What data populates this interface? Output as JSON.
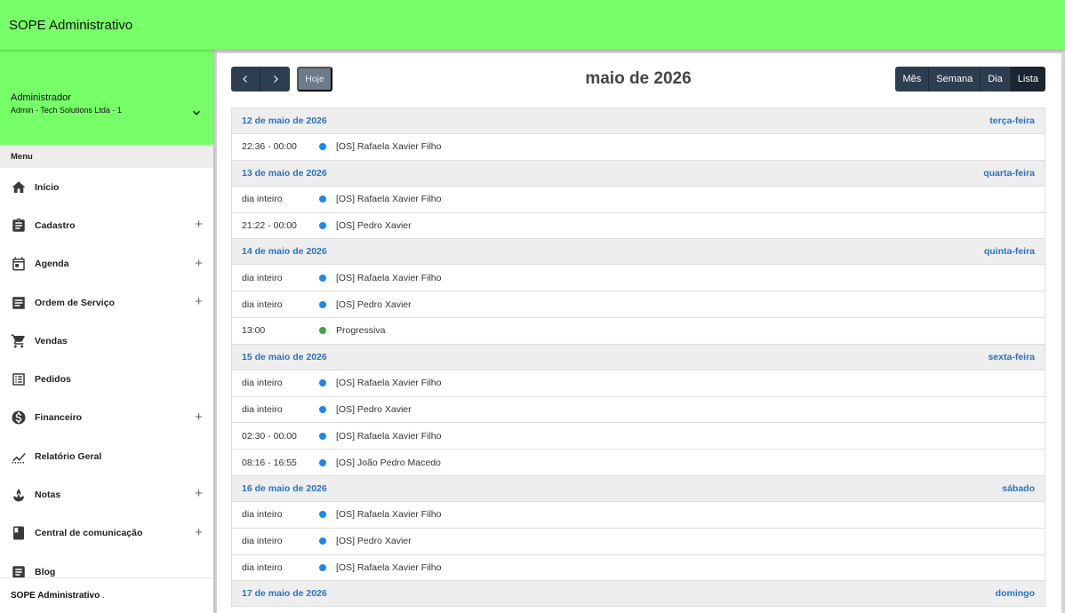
{
  "topbar": {
    "title": "SOPE Administrativo"
  },
  "user": {
    "name": "Administrador",
    "company": "Admin - Tech Solutions Ltda - 1"
  },
  "menu": {
    "header": "Menu",
    "items": [
      {
        "label": "Início",
        "icon": "home-icon",
        "expandable": false
      },
      {
        "label": "Cadastro",
        "icon": "clipboard-icon",
        "expandable": true
      },
      {
        "label": "Agenda",
        "icon": "calendar-icon",
        "expandable": true
      },
      {
        "label": "Ordem de Serviço",
        "icon": "document-list-icon",
        "expandable": true
      },
      {
        "label": "Vendas",
        "icon": "cart-icon",
        "expandable": false
      },
      {
        "label": "Pedidos",
        "icon": "list-icon",
        "expandable": false
      },
      {
        "label": "Financeiro",
        "icon": "dollar-icon",
        "expandable": true
      },
      {
        "label": "Relatório Geral",
        "icon": "chart-line-icon",
        "expandable": false
      },
      {
        "label": "Notas",
        "icon": "spa-icon",
        "expandable": true
      },
      {
        "label": "Central de comunicação",
        "icon": "book-icon",
        "expandable": true
      },
      {
        "label": "Blog",
        "icon": "article-icon",
        "expandable": false
      }
    ]
  },
  "footer": {
    "brand": "SOPE Administrativo",
    "suffix": " ."
  },
  "toolbar": {
    "today": "Hoje",
    "title": "maio de 2026",
    "views": [
      "Mês",
      "Semana",
      "Dia",
      "Lista"
    ],
    "active_view": "Lista"
  },
  "colors": {
    "topbar": "#76ff66",
    "button": "#2c3e50",
    "link": "#2a73c5",
    "event_blue": "#1e88e5",
    "event_green": "#43a047"
  },
  "days": [
    {
      "date": "12 de maio de 2026",
      "weekday": "terça-feira",
      "events": [
        {
          "time": "22:36 - 00:00",
          "title": "[OS] Rafaela Xavier Filho",
          "color": "#1e88e5"
        }
      ]
    },
    {
      "date": "13 de maio de 2026",
      "weekday": "quarta-feira",
      "events": [
        {
          "time": "dia inteiro",
          "title": "[OS] Rafaela Xavier Filho",
          "color": "#1e88e5"
        },
        {
          "time": "21:22 - 00:00",
          "title": "[OS] Pedro Xavier",
          "color": "#1e88e5"
        }
      ]
    },
    {
      "date": "14 de maio de 2026",
      "weekday": "quinta-feira",
      "events": [
        {
          "time": "dia inteiro",
          "title": "[OS] Rafaela Xavier Filho",
          "color": "#1e88e5"
        },
        {
          "time": "dia inteiro",
          "title": "[OS] Pedro Xavier",
          "color": "#1e88e5"
        },
        {
          "time": "13:00",
          "title": "Progressiva",
          "color": "#43a047"
        }
      ]
    },
    {
      "date": "15 de maio de 2026",
      "weekday": "sexta-feira",
      "events": [
        {
          "time": "dia inteiro",
          "title": "[OS] Rafaela Xavier Filho",
          "color": "#1e88e5"
        },
        {
          "time": "dia inteiro",
          "title": "[OS] Pedro Xavier",
          "color": "#1e88e5"
        },
        {
          "time": "02:30 - 00:00",
          "title": "[OS] Rafaela Xavier Filho",
          "color": "#1e88e5"
        },
        {
          "time": "08:16 - 16:55",
          "title": "[OS] João Pedro Macedo",
          "color": "#1e88e5"
        }
      ]
    },
    {
      "date": "16 de maio de 2026",
      "weekday": "sábado",
      "events": [
        {
          "time": "dia inteiro",
          "title": "[OS] Rafaela Xavier Filho",
          "color": "#1e88e5"
        },
        {
          "time": "dia inteiro",
          "title": "[OS] Pedro Xavier",
          "color": "#1e88e5"
        },
        {
          "time": "dia inteiro",
          "title": "[OS] Rafaela Xavier Filho",
          "color": "#1e88e5"
        }
      ]
    },
    {
      "date": "17 de maio de 2026",
      "weekday": "domingo",
      "events": []
    }
  ]
}
